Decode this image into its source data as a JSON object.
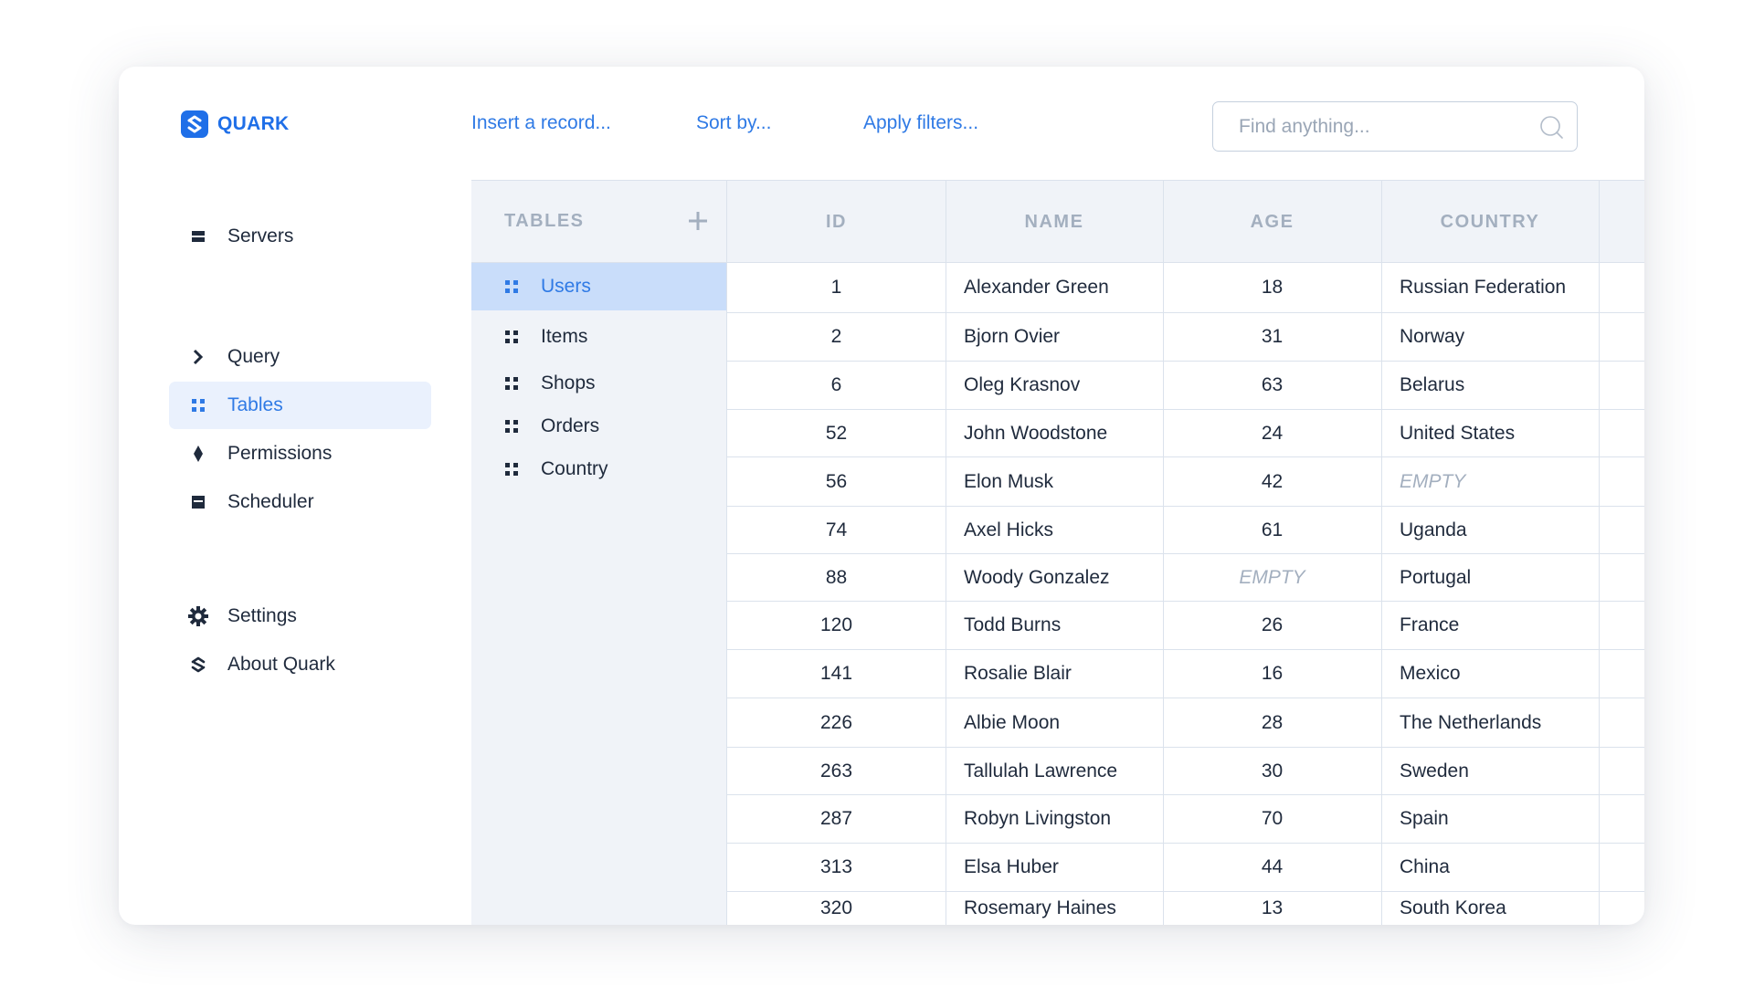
{
  "app": {
    "name": "QUARK"
  },
  "sidebar": {
    "items": [
      {
        "label": "Servers",
        "icon": "server-icon"
      },
      {
        "label": "Query",
        "icon": "chevron-right-icon"
      },
      {
        "label": "Tables",
        "icon": "grid-icon",
        "active": true
      },
      {
        "label": "Permissions",
        "icon": "diamond-icon"
      },
      {
        "label": "Scheduler",
        "icon": "scheduler-icon"
      },
      {
        "label": "Settings",
        "icon": "gear-icon"
      },
      {
        "label": "About Quark",
        "icon": "quark-logo-icon"
      }
    ]
  },
  "toolbar": {
    "insert_label": "Insert a record...",
    "sort_label": "Sort by...",
    "filter_label": "Apply filters...",
    "search_placeholder": "Find anything..."
  },
  "tables_panel": {
    "title": "TABLES",
    "items": [
      {
        "label": "Users",
        "active": true
      },
      {
        "label": "Items"
      },
      {
        "label": "Shops"
      },
      {
        "label": "Orders"
      },
      {
        "label": "Country"
      }
    ]
  },
  "grid": {
    "columns": [
      "ID",
      "NAME",
      "AGE",
      "COUNTRY"
    ],
    "empty_text": "EMPTY",
    "rows": [
      {
        "id": "1",
        "name": "Alexander Green",
        "age": "18",
        "country": "Russian Federation"
      },
      {
        "id": "2",
        "name": "Bjorn Ovier",
        "age": "31",
        "country": "Norway"
      },
      {
        "id": "6",
        "name": "Oleg Krasnov",
        "age": "63",
        "country": "Belarus"
      },
      {
        "id": "52",
        "name": "John Woodstone",
        "age": "24",
        "country": "United States"
      },
      {
        "id": "56",
        "name": "Elon Musk",
        "age": "42",
        "country": "EMPTY"
      },
      {
        "id": "74",
        "name": "Axel Hicks",
        "age": "61",
        "country": "Uganda"
      },
      {
        "id": "88",
        "name": "Woody Gonzalez",
        "age": "EMPTY",
        "country": "Portugal"
      },
      {
        "id": "120",
        "name": "Todd Burns",
        "age": "26",
        "country": "France"
      },
      {
        "id": "141",
        "name": "Rosalie Blair",
        "age": "16",
        "country": "Mexico"
      },
      {
        "id": "226",
        "name": "Albie Moon",
        "age": "28",
        "country": "The Netherlands"
      },
      {
        "id": "263",
        "name": "Tallulah Lawrence",
        "age": "30",
        "country": "Sweden"
      },
      {
        "id": "287",
        "name": "Robyn Livingston",
        "age": "70",
        "country": "Spain"
      },
      {
        "id": "313",
        "name": "Elsa Huber",
        "age": "44",
        "country": "China"
      },
      {
        "id": "320",
        "name": "Rosemary Haines",
        "age": "13",
        "country": "South Korea"
      }
    ]
  },
  "colors": {
    "accent": "#2f7ae5",
    "brand": "#1f6fe8",
    "active_nav_bg": "#eaf1fd",
    "active_table_bg": "#c9ddfa",
    "panel_bg": "#f0f3f8",
    "muted": "#a3afbf"
  }
}
